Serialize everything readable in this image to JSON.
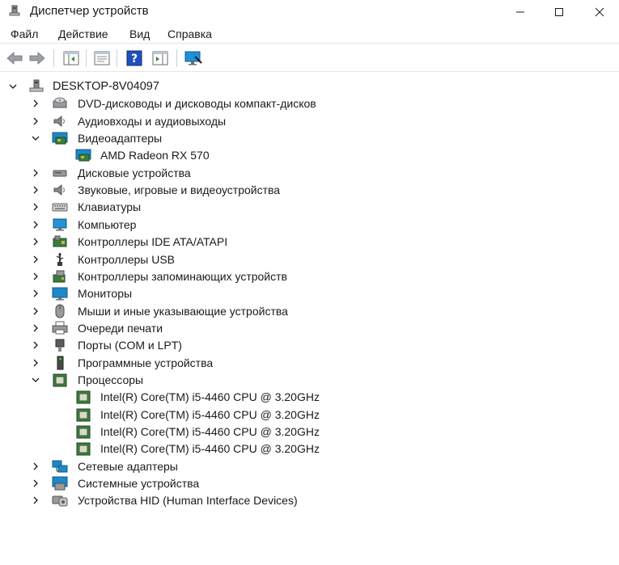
{
  "window": {
    "title": "Диспетчер устройств"
  },
  "menu": {
    "items": [
      "Файл",
      "Действие",
      "Вид",
      "Справка"
    ]
  },
  "tree": {
    "root": "DESKTOP-8V04097",
    "categories": [
      {
        "label": "DVD-дисководы и дисководы компакт-дисков",
        "icon": "dvd-drive-icon",
        "expanded": false
      },
      {
        "label": "Аудиовходы и аудиовыходы",
        "icon": "speaker-icon",
        "expanded": false
      },
      {
        "label": "Видеоадаптеры",
        "icon": "display-adapter-icon",
        "expanded": true,
        "children": [
          {
            "label": "AMD Radeon RX 570",
            "icon": "display-adapter-icon"
          }
        ]
      },
      {
        "label": "Дисковые устройства",
        "icon": "disk-drive-icon",
        "expanded": false
      },
      {
        "label": "Звуковые, игровые и видеоустройства",
        "icon": "speaker-icon",
        "expanded": false
      },
      {
        "label": "Клавиатуры",
        "icon": "keyboard-icon",
        "expanded": false
      },
      {
        "label": "Компьютер",
        "icon": "computer-icon",
        "expanded": false
      },
      {
        "label": "Контроллеры IDE ATA/ATAPI",
        "icon": "ide-controller-icon",
        "expanded": false
      },
      {
        "label": "Контроллеры USB",
        "icon": "usb-icon",
        "expanded": false
      },
      {
        "label": "Контроллеры запоминающих устройств",
        "icon": "storage-controller-icon",
        "expanded": false
      },
      {
        "label": "Мониторы",
        "icon": "monitor-icon",
        "expanded": false
      },
      {
        "label": "Мыши и иные указывающие устройства",
        "icon": "mouse-icon",
        "expanded": false
      },
      {
        "label": "Очереди печати",
        "icon": "printer-icon",
        "expanded": false
      },
      {
        "label": "Порты (COM и LPT)",
        "icon": "port-icon",
        "expanded": false
      },
      {
        "label": "Программные устройства",
        "icon": "software-device-icon",
        "expanded": false
      },
      {
        "label": "Процессоры",
        "icon": "processor-icon",
        "expanded": true,
        "children": [
          {
            "label": "Intel(R) Core(TM) i5-4460  CPU @ 3.20GHz",
            "icon": "processor-icon"
          },
          {
            "label": "Intel(R) Core(TM) i5-4460  CPU @ 3.20GHz",
            "icon": "processor-icon"
          },
          {
            "label": "Intel(R) Core(TM) i5-4460  CPU @ 3.20GHz",
            "icon": "processor-icon"
          },
          {
            "label": "Intel(R) Core(TM) i5-4460  CPU @ 3.20GHz",
            "icon": "processor-icon"
          }
        ]
      },
      {
        "label": "Сетевые адаптеры",
        "icon": "network-adapter-icon",
        "expanded": false
      },
      {
        "label": "Системные устройства",
        "icon": "system-device-icon",
        "expanded": false
      },
      {
        "label": "Устройства HID (Human Interface Devices)",
        "icon": "hid-icon",
        "expanded": false
      }
    ]
  },
  "toolbar": {
    "buttons": [
      "back-arrow-icon",
      "forward-arrow-icon",
      "show-hide-tree-icon",
      "properties-icon",
      "help-icon",
      "action-pane-icon",
      "scan-hardware-icon"
    ]
  },
  "colors": {
    "window_bg": "#ffffff",
    "text": "#1a1a1a",
    "separator": "#e6e6e6",
    "accent": "#0067c0"
  }
}
